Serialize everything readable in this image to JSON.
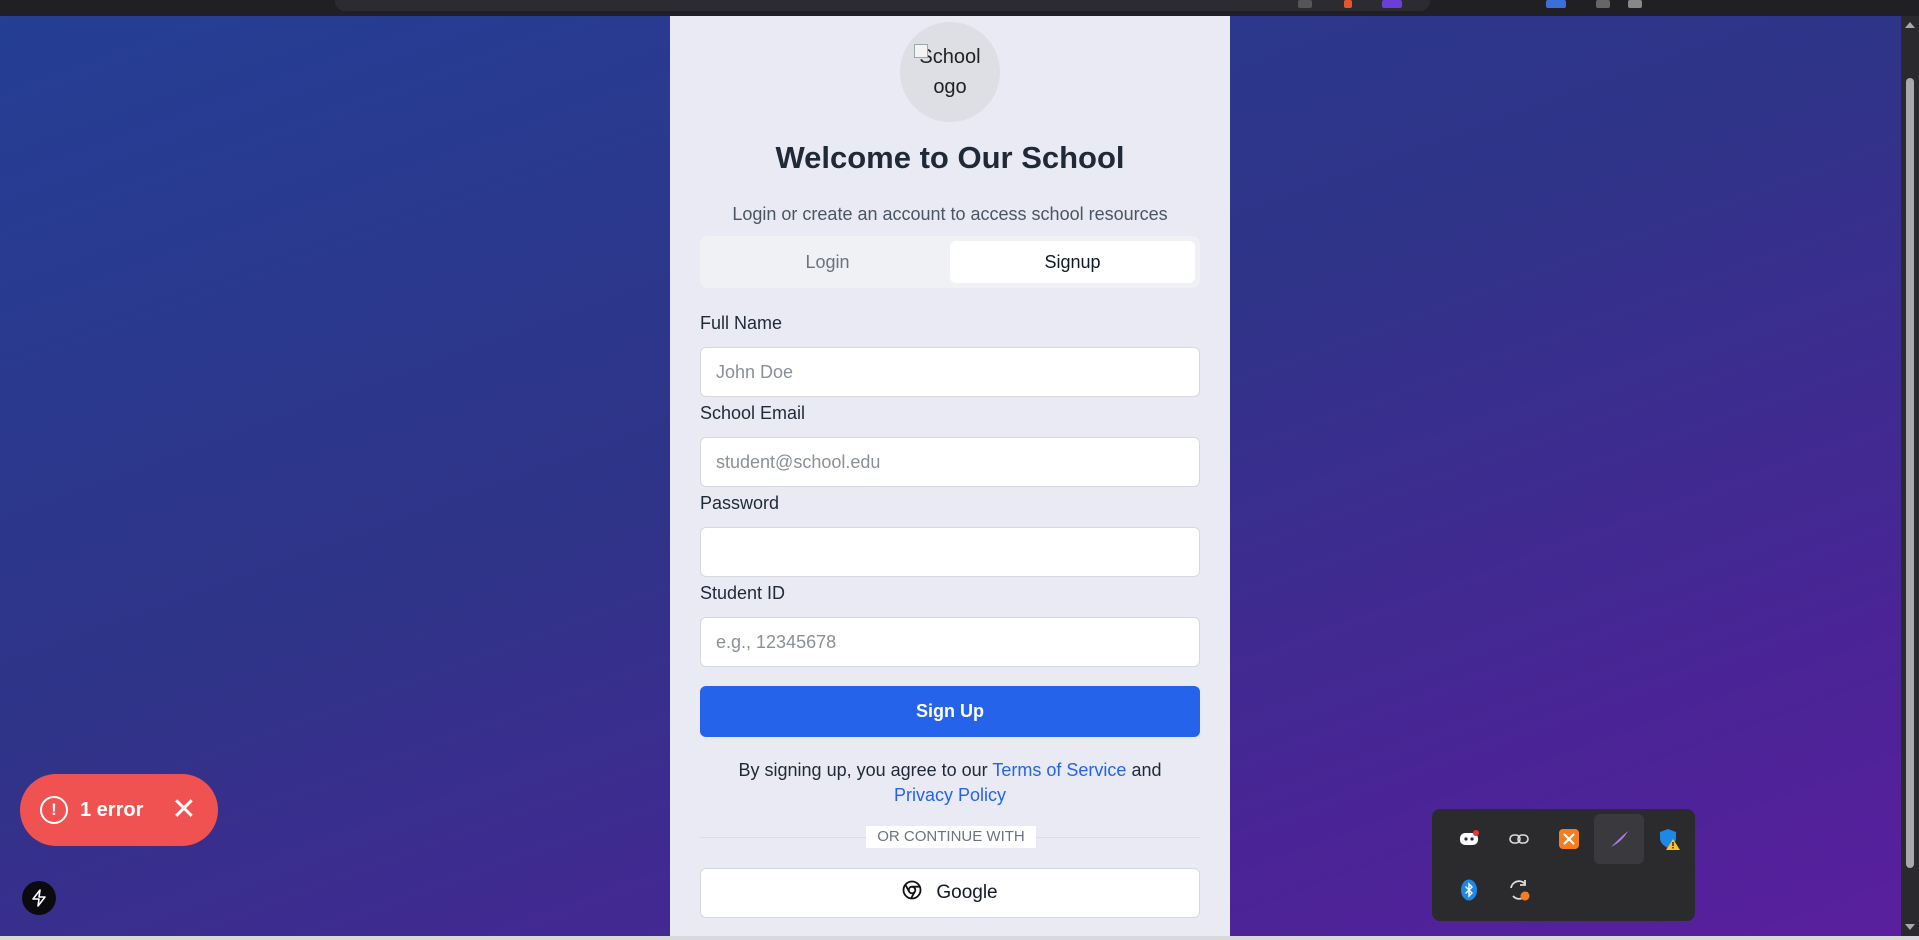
{
  "app": {
    "logo_alt_line1": "School",
    "logo_alt_line2": "ogo",
    "title": "Welcome to Our School",
    "subtitle": "Login or create an account to access school resources"
  },
  "tabs": [
    {
      "label": "Login",
      "active": false
    },
    {
      "label": "Signup",
      "active": true
    }
  ],
  "form": {
    "full_name": {
      "label": "Full Name",
      "placeholder": "John Doe",
      "value": ""
    },
    "email": {
      "label": "School Email",
      "placeholder": "student@school.edu",
      "value": ""
    },
    "password": {
      "label": "Password",
      "placeholder": "",
      "value": ""
    },
    "student_id": {
      "label": "Student ID",
      "placeholder": "e.g., 12345678",
      "value": ""
    },
    "submit_label": "Sign Up"
  },
  "terms": {
    "prefix": "By signing up, you agree to our",
    "tos_link": "Terms of Service",
    "middle": "and",
    "privacy_link": "Privacy Policy"
  },
  "divider_text": "OR CONTINUE WITH",
  "google_label": "Google",
  "toast": {
    "message": "1 error"
  },
  "colors": {
    "primary": "#2563eb",
    "error": "#f05252",
    "card_bg": "#e9eaf3"
  },
  "tray_icons": [
    "discord-icon",
    "link-icon",
    "xampp-icon",
    "feather-icon",
    "shield-warning-icon",
    "bluetooth-icon",
    "sync-icon"
  ]
}
